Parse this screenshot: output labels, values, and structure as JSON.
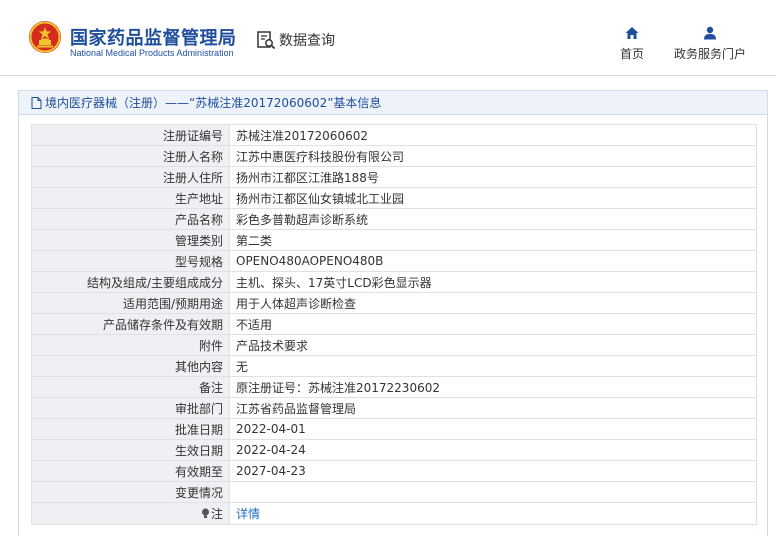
{
  "header": {
    "brand_cn": "国家药品监督管理局",
    "brand_en": "National Medical Products Administration",
    "data_query": "数据查询",
    "nav_home": "首页",
    "nav_gov_service": "政务服务门户"
  },
  "panel": {
    "title": "境内医疗器械（注册）——“苏械注准20172060602”基本信息"
  },
  "rows": [
    {
      "label": "注册证编号",
      "value": "苏械注准20172060602"
    },
    {
      "label": "注册人名称",
      "value": "江苏中惠医疗科技股份有限公司"
    },
    {
      "label": "注册人住所",
      "value": "扬州市江都区江淮路188号"
    },
    {
      "label": "生产地址",
      "value": "扬州市江都区仙女镇城北工业园"
    },
    {
      "label": "产品名称",
      "value": "彩色多普勒超声诊断系统"
    },
    {
      "label": "管理类别",
      "value": "第二类"
    },
    {
      "label": "型号规格",
      "value": "OPENO480AOPENO480B"
    },
    {
      "label": "结构及组成/主要组成成分",
      "value": "主机、探头、17英寸LCD彩色显示器"
    },
    {
      "label": "适用范围/预期用途",
      "value": "用于人体超声诊断检查"
    },
    {
      "label": "产品储存条件及有效期",
      "value": "不适用"
    },
    {
      "label": "附件",
      "value": "产品技术要求"
    },
    {
      "label": "其他内容",
      "value": "无"
    },
    {
      "label": "备注",
      "value": "原注册证号：苏械注准20172230602"
    },
    {
      "label": "审批部门",
      "value": "江苏省药品监督管理局"
    },
    {
      "label": "批准日期",
      "value": "2022-04-01"
    },
    {
      "label": "生效日期",
      "value": "2022-04-24"
    },
    {
      "label": "有效期至",
      "value": "2027-04-23"
    },
    {
      "label": "变更情况",
      "value": ""
    }
  ],
  "note": {
    "label": "注",
    "link": "详情"
  },
  "colors": {
    "brand_blue": "#1f4e9c",
    "link_blue": "#1f6fc5",
    "emblem_red": "#d42b1e",
    "emblem_gold": "#f2c230"
  }
}
